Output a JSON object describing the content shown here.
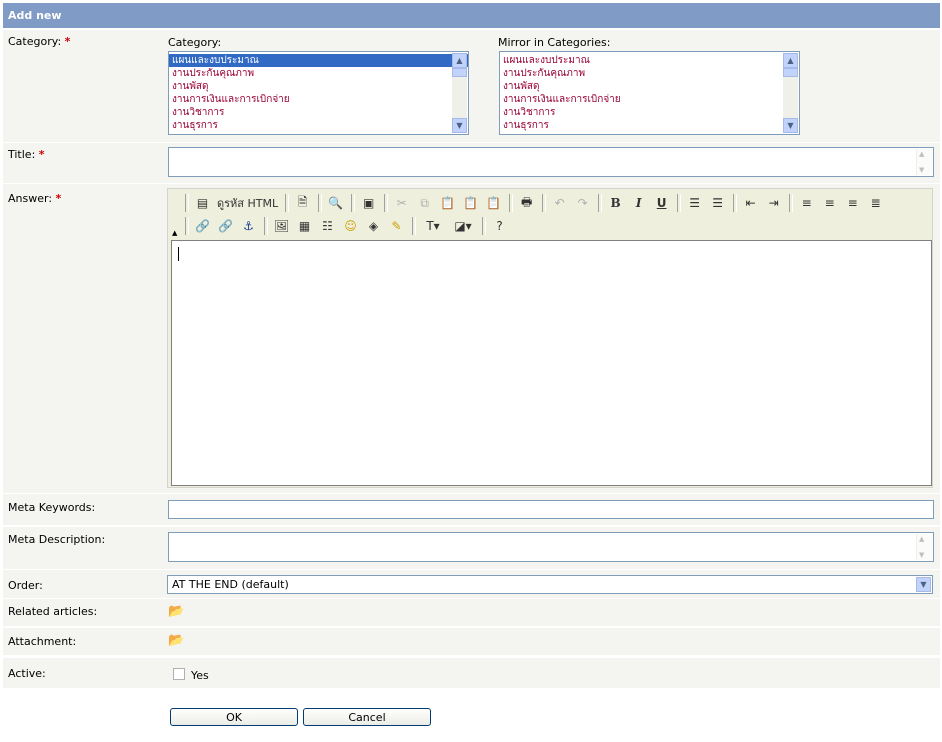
{
  "header": {
    "title": "Add new"
  },
  "category": {
    "label": "Category:",
    "required_mark": "*",
    "list_label": "Category:",
    "options": [
      "แผนและงบประมาณ",
      "งานประกันคุณภาพ",
      "งานพัสดุ",
      "งานการเงินและการเบิกจ่าย",
      "งานวิชาการ",
      "งานธุรการ"
    ],
    "selected": "แผนและงบประมาณ"
  },
  "mirror": {
    "list_label": "Mirror in Categories:",
    "options": [
      "แผนและงบประมาณ",
      "งานประกันคุณภาพ",
      "งานพัสดุ",
      "งานการเงินและการเบิกจ่าย",
      "งานวิชาการ",
      "งานธุรการ"
    ]
  },
  "title_field": {
    "label": "Title:",
    "required_mark": "*",
    "value": ""
  },
  "answer": {
    "label": "Answer:",
    "required_mark": "*",
    "view_html_label": "ดูรหัส HTML",
    "value": ""
  },
  "meta_keywords": {
    "label": "Meta Keywords:",
    "value": ""
  },
  "meta_description": {
    "label": "Meta Description:",
    "value": ""
  },
  "order": {
    "label": "Order:",
    "selected": "AT THE END (default)"
  },
  "related": {
    "label": "Related articles:"
  },
  "attachment": {
    "label": "Attachment:"
  },
  "active": {
    "label": "Active:",
    "option_label": "Yes",
    "checked": false
  },
  "buttons": {
    "ok": "OK",
    "cancel": "Cancel"
  },
  "colors": {
    "header_bg": "#7f9bc6",
    "row_bg": "#f4f4f1",
    "required": "#cc0000",
    "list_text": "#990033",
    "selection": "#316ac5"
  }
}
